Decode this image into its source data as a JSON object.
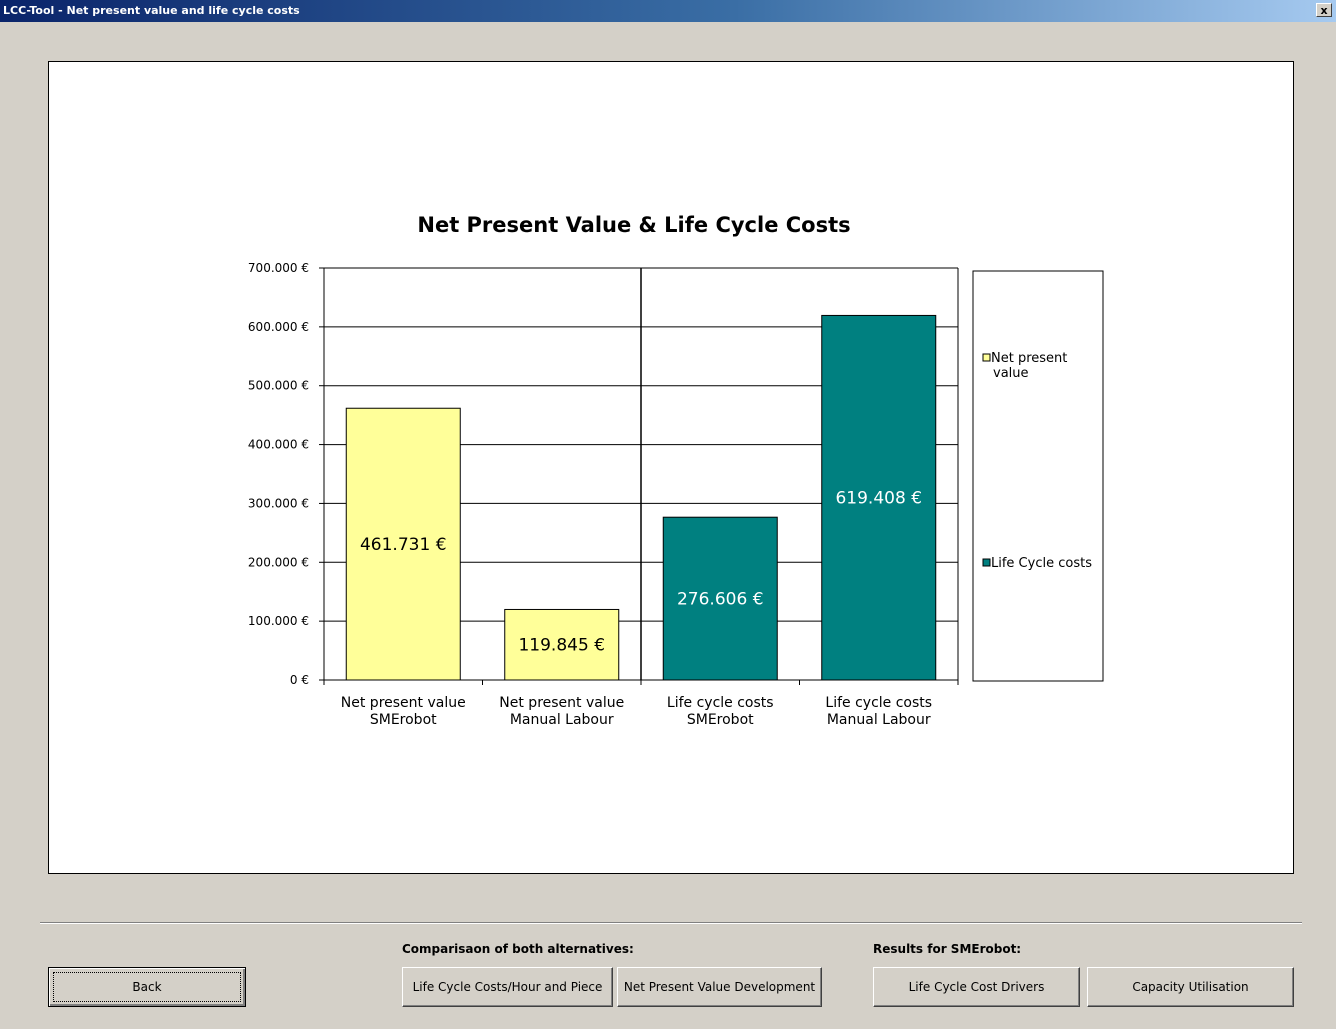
{
  "window": {
    "title": "LCC-Tool  -  Net present value and life cycle costs",
    "close_label": "x"
  },
  "chart_data": {
    "type": "bar",
    "title": "Net Present Value & Life Cycle Costs",
    "categories": [
      [
        "Net present value",
        "SMErobot"
      ],
      [
        "Net present value",
        "Manual Labour"
      ],
      [
        "Life cycle costs",
        "SMErobot"
      ],
      [
        "Life cycle costs",
        "Manual Labour"
      ]
    ],
    "values": [
      461731,
      119845,
      276606,
      619408
    ],
    "value_labels": [
      "461.731 €",
      "119.845 €",
      "276.606 €",
      "619.408 €"
    ],
    "series_of_bar": [
      0,
      0,
      1,
      1
    ],
    "series": [
      {
        "name": "Net present value",
        "color": "#ffff99"
      },
      {
        "name": "Life Cycle costs",
        "color": "#008080"
      }
    ],
    "legend_lines": [
      [
        "Net present",
        "value"
      ],
      [
        "Life Cycle costs"
      ]
    ],
    "yticks": [
      0,
      100000,
      200000,
      300000,
      400000,
      500000,
      600000,
      700000
    ],
    "ytick_labels": [
      "0 €",
      "100.000 €",
      "200.000 €",
      "300.000 €",
      "400.000 €",
      "500.000 €",
      "600.000 €",
      "700.000 €"
    ],
    "ylim": [
      0,
      700000
    ],
    "xlabel": "",
    "ylabel": "",
    "grid": true,
    "legend_position": "right"
  },
  "controls": {
    "back_label": "Back",
    "comparison_label": "Comparisaon of both alternatives:",
    "lcc_hour_piece_label": "Life Cycle Costs/Hour and Piece",
    "npv_development_label": "Net Present Value Development",
    "results_label": "Results for SMErobot:",
    "lcc_drivers_label": "Life Cycle Cost Drivers",
    "capacity_label": "Capacity Utilisation"
  }
}
